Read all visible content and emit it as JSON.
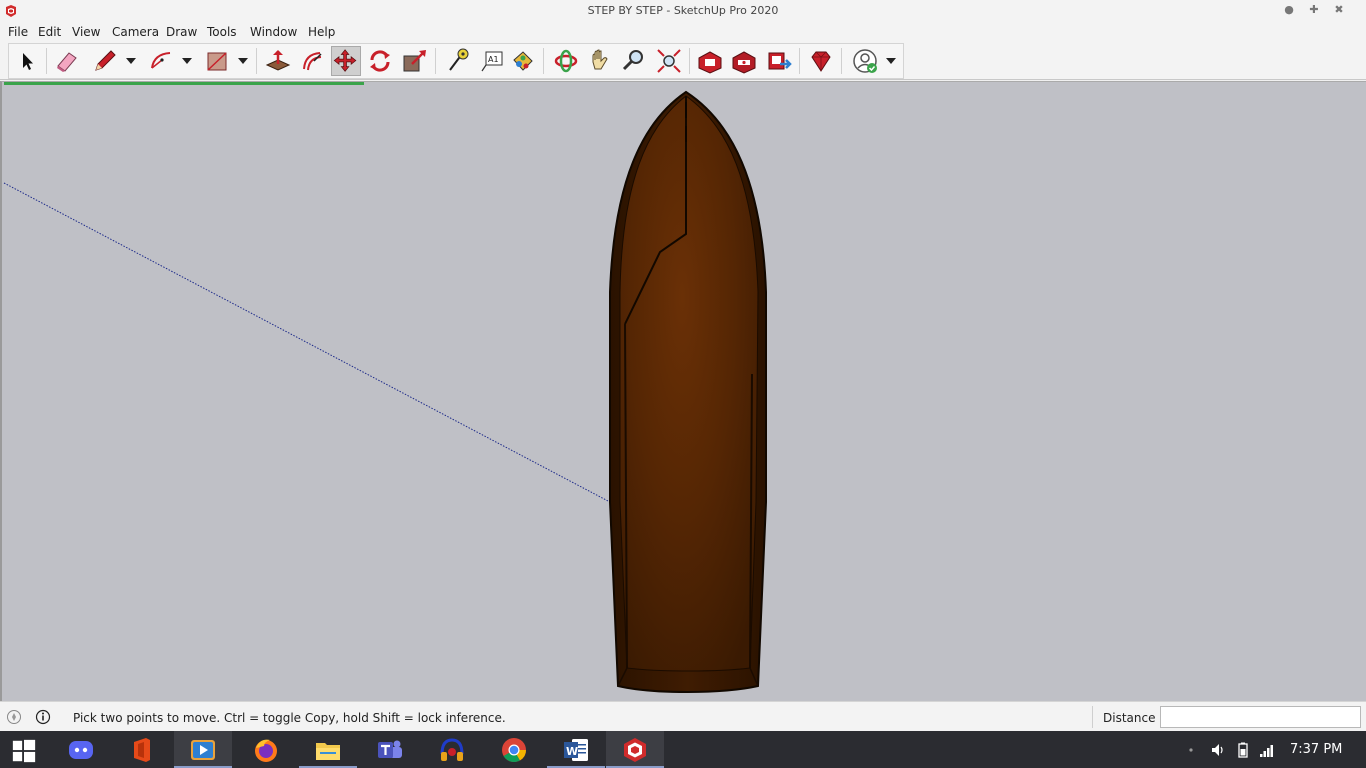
{
  "window": {
    "title": "STEP BY STEP - SketchUp Pro 2020",
    "controls": [
      "minimize-icon",
      "maximize-icon",
      "close-icon"
    ]
  },
  "menu": {
    "items": [
      "File",
      "Edit",
      "View",
      "Camera",
      "Draw",
      "Tools",
      "Window",
      "Help"
    ]
  },
  "toolbar": {
    "tools": [
      {
        "name": "select-tool",
        "icon": "arrow-cursor-icon"
      },
      {
        "name": "eraser-tool",
        "icon": "eraser-icon"
      },
      {
        "name": "line-tool",
        "icon": "pencil-icon"
      },
      {
        "name": "arc-tool",
        "icon": "arc-icon"
      },
      {
        "name": "rectangle-tool",
        "icon": "rectangle-icon"
      },
      {
        "name": "push-pull-tool",
        "icon": "push-pull-icon"
      },
      {
        "name": "offset-tool",
        "icon": "offset-icon"
      },
      {
        "name": "move-tool",
        "icon": "move-arrows-icon",
        "active": true
      },
      {
        "name": "rotate-tool",
        "icon": "rotate-icon"
      },
      {
        "name": "scale-tool",
        "icon": "scale-icon"
      },
      {
        "name": "tape-measure-tool",
        "icon": "tape-measure-icon"
      },
      {
        "name": "text-tool",
        "icon": "text-label-icon"
      },
      {
        "name": "paint-bucket-tool",
        "icon": "paint-bucket-icon"
      },
      {
        "name": "orbit-tool",
        "icon": "orbit-icon"
      },
      {
        "name": "pan-tool",
        "icon": "hand-icon"
      },
      {
        "name": "zoom-tool",
        "icon": "magnifier-icon"
      },
      {
        "name": "zoom-extents-tool",
        "icon": "zoom-extents-icon"
      },
      {
        "name": "3d-warehouse-tool",
        "icon": "warehouse-icon"
      },
      {
        "name": "extension-warehouse-tool",
        "icon": "extension-warehouse-icon"
      },
      {
        "name": "share-model-tool",
        "icon": "share-model-icon"
      },
      {
        "name": "extension-manager-tool",
        "icon": "ruby-gem-icon"
      },
      {
        "name": "account-tool",
        "icon": "user-account-icon"
      }
    ]
  },
  "status": {
    "hint": "Pick two points to move.  Ctrl = toggle Copy, hold Shift = lock inference.",
    "vcb_label": "Distance",
    "vcb_value": ""
  },
  "taskbar": {
    "apps": [
      "windows-start-icon",
      "discord-icon",
      "office-icon",
      "media-player-icon",
      "firefox-icon",
      "file-explorer-icon",
      "teams-icon",
      "headphones-app-icon",
      "chrome-icon",
      "word-icon",
      "sketchup-icon"
    ],
    "active_app": "sketchup-icon",
    "clock": "7:37 PM"
  },
  "colors": {
    "viewport": "#bfc0c6",
    "hull_dark": "#2a1200",
    "hull_mid": "#5a2a05",
    "accent_red": "#c8202a",
    "inference_line": "#1d2a8a"
  }
}
